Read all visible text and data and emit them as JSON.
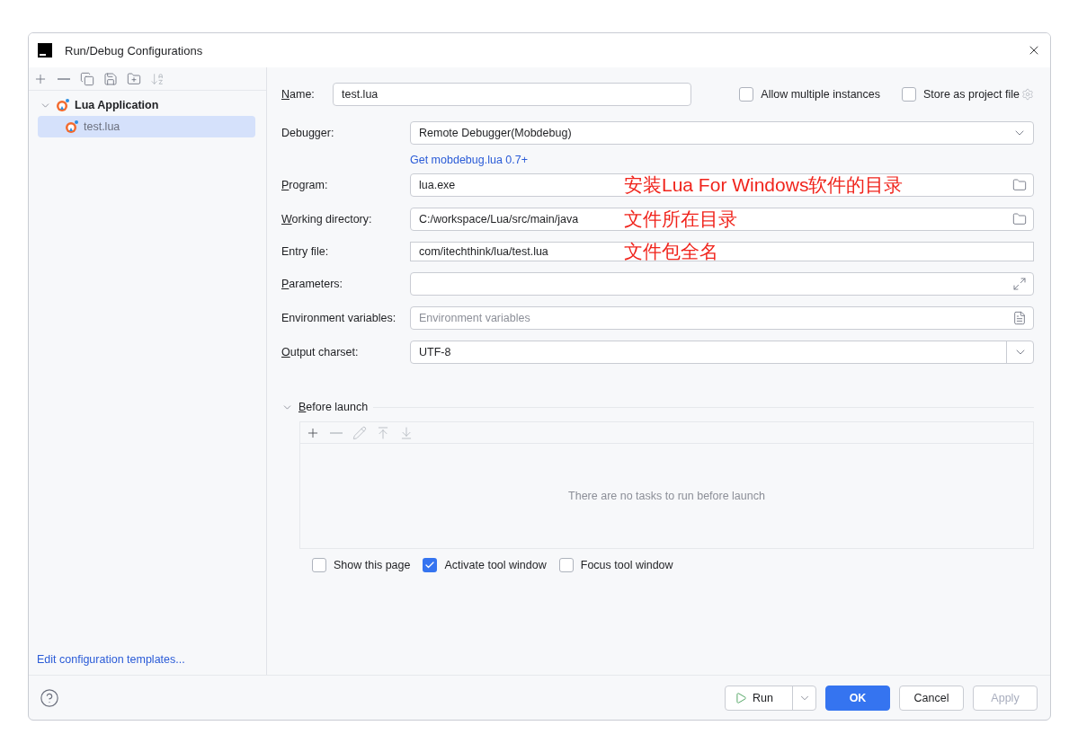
{
  "window": {
    "title": "Run/Debug Configurations"
  },
  "sidebar": {
    "tree": [
      {
        "label": "Lua Application",
        "expanded": true,
        "children": [
          {
            "label": "test.lua",
            "selected": true
          }
        ]
      }
    ],
    "footer_link": "Edit configuration templates..."
  },
  "name_row": {
    "label": "Name:",
    "mnemonic": true,
    "value": "test.lua",
    "options": [
      {
        "label": "Allow multiple instances",
        "checked": false
      },
      {
        "label": "Store as project file",
        "checked": false
      }
    ]
  },
  "fields": [
    {
      "kind": "dropdown",
      "label": "Debugger:",
      "mnemonic": false,
      "value": "Remote Debugger(Mobdebug)"
    },
    {
      "kind": "link",
      "text": "Get mobdebug.lua 0.7+"
    },
    {
      "kind": "browse",
      "label": "Program:",
      "mnemonic": true,
      "value": "lua.exe",
      "annotation": "安装Lua For Windows软件的目录"
    },
    {
      "kind": "browse",
      "label": "Working directory:",
      "mnemonic": true,
      "value": "C:/workspace/Lua/src/main/java",
      "annotation": "文件所在目录"
    },
    {
      "kind": "plain",
      "label": "Entry file:",
      "mnemonic": false,
      "value": "com/itechthink/lua/test.lua",
      "annotation": "文件包全名"
    },
    {
      "kind": "expand",
      "label": "Parameters:",
      "mnemonic": true
    },
    {
      "kind": "list",
      "label": "Environment variables:",
      "mnemonic": false,
      "placeholder": "Environment variables"
    },
    {
      "kind": "combo",
      "label": "Output charset:",
      "mnemonic": true,
      "value": "UTF-8"
    }
  ],
  "before_launch": {
    "label": "Before launch",
    "expanded": true,
    "empty_text": "There are no tasks to run before launch",
    "options": [
      {
        "label": "Show this page",
        "checked": false
      },
      {
        "label": "Activate tool window",
        "checked": true
      },
      {
        "label": "Focus tool window",
        "checked": false
      }
    ]
  },
  "buttons": [
    {
      "kind": "split",
      "label": "Run",
      "disabled": false
    },
    {
      "kind": "primary",
      "label": "OK",
      "disabled": false
    },
    {
      "kind": "normal",
      "label": "Cancel",
      "disabled": false
    },
    {
      "kind": "normal",
      "label": "Apply",
      "disabled": true
    }
  ]
}
